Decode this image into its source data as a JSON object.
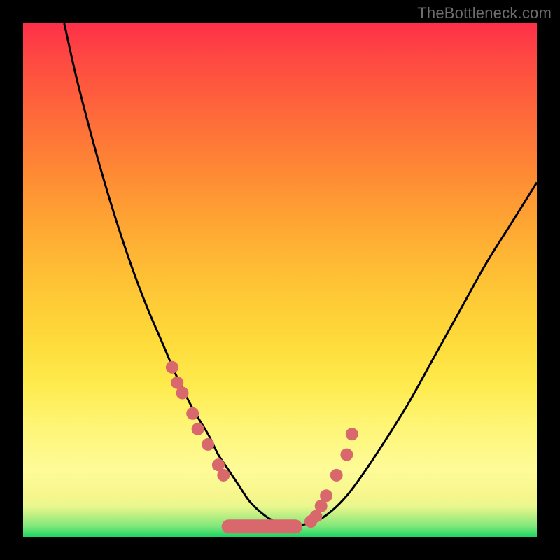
{
  "watermark": "TheBottleneck.com",
  "chart_data": {
    "type": "line",
    "title": "",
    "xlabel": "",
    "ylabel": "",
    "xlim": [
      0,
      100
    ],
    "ylim": [
      0,
      100
    ],
    "series": [
      {
        "name": "curve",
        "x": [
          8,
          10,
          12,
          15,
          18,
          21,
          24,
          27,
          30,
          33,
          36,
          38,
          40,
          42,
          44,
          46,
          48,
          50,
          52,
          54,
          57,
          60,
          63,
          66,
          70,
          75,
          80,
          85,
          90,
          95,
          100
        ],
        "y": [
          100,
          91,
          83,
          72,
          62,
          53,
          45,
          38,
          31,
          25,
          20,
          16,
          13,
          10,
          7,
          5,
          3.5,
          2.5,
          2,
          2.3,
          3,
          5,
          8,
          12,
          18,
          26,
          35,
          44,
          53,
          61,
          69
        ]
      }
    ],
    "markers": {
      "left_cluster_x": [
        29,
        30,
        31,
        33,
        34,
        36,
        38,
        39
      ],
      "left_cluster_y": [
        33,
        30,
        28,
        24,
        21,
        18,
        14,
        12
      ],
      "right_cluster_x": [
        56,
        57,
        58,
        59,
        61,
        63,
        64
      ],
      "right_cluster_y": [
        3,
        4,
        6,
        8,
        12,
        16,
        20
      ],
      "bottom_bar_x": [
        40,
        42,
        44,
        46,
        48,
        50,
        52,
        53
      ],
      "bottom_bar_y": [
        2,
        2,
        2,
        2,
        2,
        2,
        2,
        2
      ]
    },
    "colors": {
      "curve": "#000000",
      "marker": "#d9686d"
    }
  }
}
